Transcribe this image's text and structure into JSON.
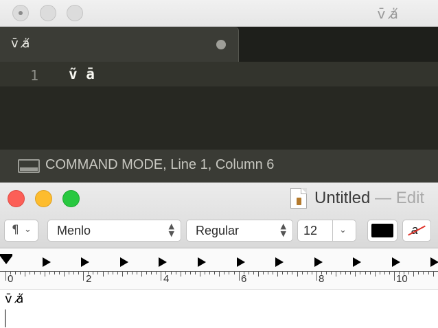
{
  "sublime": {
    "window_title": "v̄ ȧ̸",
    "tab_label": "v̄ ȧ̸",
    "line_number": "1",
    "code_line": "ṽ ā",
    "status_text": "COMMAND MODE, Line 1, Column 6"
  },
  "textedit": {
    "title": "Untitled",
    "title_suffix": " — Edit",
    "paragraph_icon": "¶",
    "font_family": "Menlo",
    "font_style": "Regular",
    "font_size": "12",
    "text_color": "#000000",
    "strike_glyph": "a",
    "ruler_labels": [
      "0",
      "2",
      "4",
      "6",
      "8",
      "10"
    ],
    "document_text": "v̄ ȧ̸"
  },
  "colors": {
    "sublime_bg": "#272822",
    "close": "#fc5f57",
    "minimize": "#fdbc2e",
    "zoom": "#28c840"
  }
}
